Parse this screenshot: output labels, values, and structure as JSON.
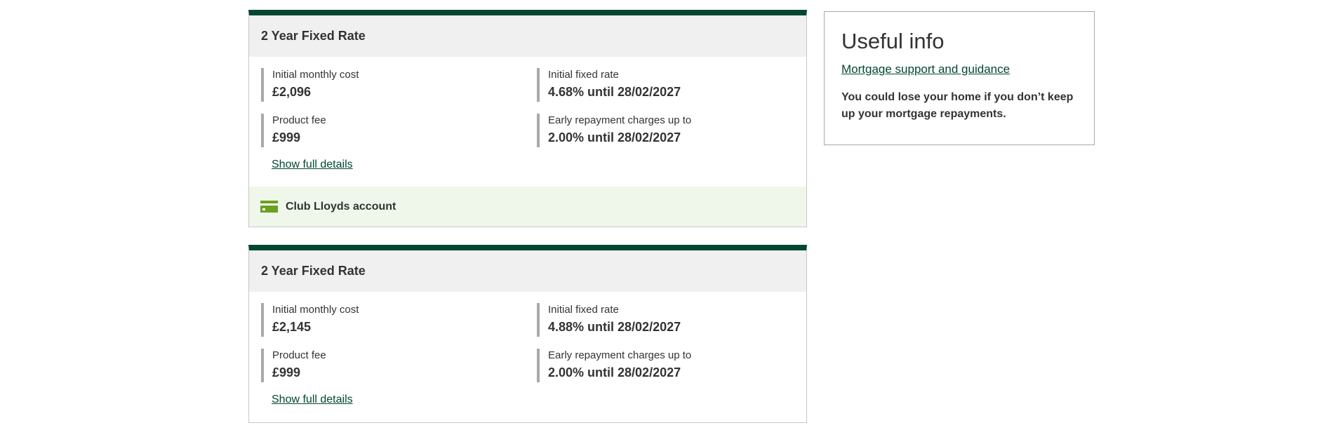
{
  "products": [
    {
      "title": "2 Year Fixed Rate",
      "initial_monthly_cost_label": "Initial monthly cost",
      "initial_monthly_cost": "£2,096",
      "initial_fixed_rate_label": "Initial fixed rate",
      "initial_fixed_rate": "4.68% until 28/02/2027",
      "product_fee_label": "Product fee",
      "product_fee": "£999",
      "erc_label": "Early repayment charges up to",
      "erc": "2.00% until 28/02/2027",
      "details_link": "Show full details",
      "footer": {
        "label": "Club Lloyds account",
        "icon": "card-icon"
      }
    },
    {
      "title": "2 Year Fixed Rate",
      "initial_monthly_cost_label": "Initial monthly cost",
      "initial_monthly_cost": "£2,145",
      "initial_fixed_rate_label": "Initial fixed rate",
      "initial_fixed_rate": "4.88% until 28/02/2027",
      "product_fee_label": "Product fee",
      "product_fee": "£999",
      "erc_label": "Early repayment charges up to",
      "erc": "2.00% until 28/02/2027",
      "details_link": "Show full details"
    }
  ],
  "useful_info": {
    "title": "Useful info",
    "link": "Mortgage support and guidance",
    "warning": "You could lose your home if you don’t keep up your mortgage repayments."
  },
  "colors": {
    "brand_green": "#024731",
    "card_icon_green": "#6aa120",
    "footer_bg": "#eef7ea"
  }
}
